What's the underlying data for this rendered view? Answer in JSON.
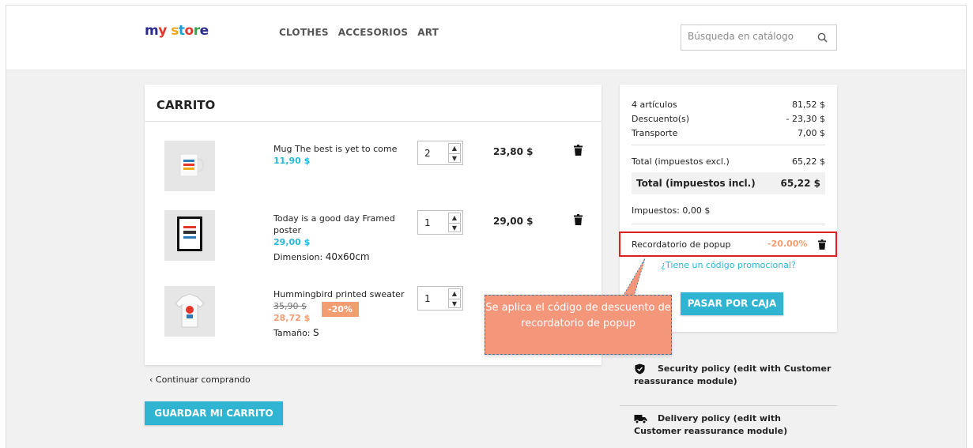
{
  "header": {
    "logo": [
      "m",
      "y",
      " ",
      "s",
      "t",
      "o",
      "r",
      "e"
    ],
    "nav": [
      "CLOTHES",
      "ACCESORIOS",
      "ART"
    ],
    "search_placeholder": "Búsqueda en catálogo"
  },
  "cart": {
    "title": "CARRITO",
    "items": [
      {
        "name": "Mug The best is yet to come",
        "price": "11,90 $",
        "qty": "2",
        "total": "23,80 $"
      },
      {
        "name": "Today is a good day Framed poster",
        "price": "29,00 $",
        "attr_label": "Dimension:",
        "attr_value": "40x60cm",
        "qty": "1",
        "total": "29,00 $"
      },
      {
        "name": "Hummingbird printed sweater",
        "old_price": "35,90 $",
        "discount_badge": "-20%",
        "price": "28,72 $",
        "attr_label": "Tamaño:",
        "attr_value": "S",
        "qty": "1"
      }
    ],
    "continue": "Continuar comprando",
    "save_button": "GUARDAR MI CARRITO"
  },
  "summary": {
    "items_label": "4 artículos",
    "items_value": "81,52 $",
    "discount_label": "Descuento(s)",
    "discount_value": "- 23,30 $",
    "shipping_label": "Transporte",
    "shipping_value": "7,00 $",
    "subtotal_label": "Total (impuestos excl.)",
    "subtotal_value": "65,22 $",
    "total_label": "Total (impuestos incl.)",
    "total_value": "65,22 $",
    "taxes": "Impuestos: 0,00 $",
    "voucher_label": "Recordatorio de popup",
    "voucher_value": "-20.00%",
    "promo_link": "¿Tiene un código promocional?",
    "checkout_button": "PASAR POR CAJA"
  },
  "tooltip": "Se aplica el código de descuento de recordatorio de popup",
  "reassurance": [
    {
      "line1": "Security policy (edit with Customer",
      "line2": "reassurance module)"
    },
    {
      "line1": "Delivery policy (edit with",
      "line2": "Customer reassurance module)"
    }
  ],
  "colors": {
    "accent": "#2fb5d2",
    "discount": "#f39d72",
    "highlight": "#e02020",
    "tooltip": "#f4967a"
  }
}
